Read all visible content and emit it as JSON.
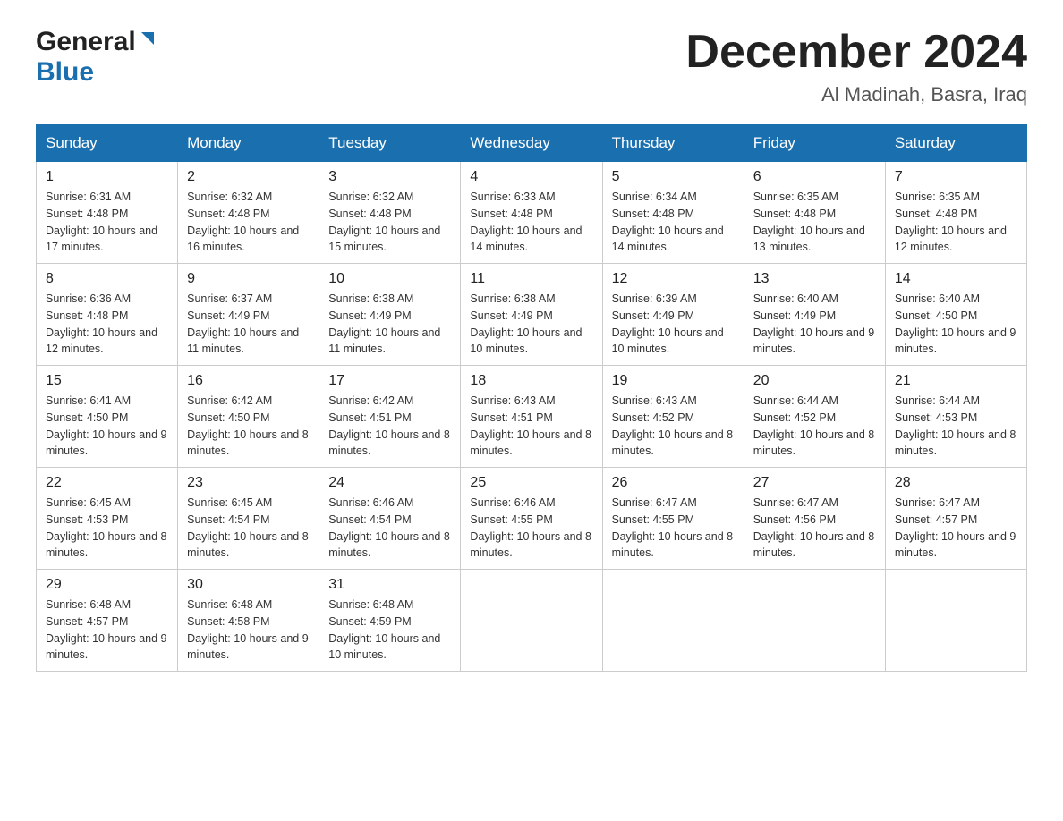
{
  "header": {
    "logo_general": "General",
    "logo_blue": "Blue",
    "title": "December 2024",
    "subtitle": "Al Madinah, Basra, Iraq"
  },
  "days_of_week": [
    "Sunday",
    "Monday",
    "Tuesday",
    "Wednesday",
    "Thursday",
    "Friday",
    "Saturday"
  ],
  "weeks": [
    [
      {
        "day": "1",
        "sunrise": "6:31 AM",
        "sunset": "4:48 PM",
        "daylight": "10 hours and 17 minutes."
      },
      {
        "day": "2",
        "sunrise": "6:32 AM",
        "sunset": "4:48 PM",
        "daylight": "10 hours and 16 minutes."
      },
      {
        "day": "3",
        "sunrise": "6:32 AM",
        "sunset": "4:48 PM",
        "daylight": "10 hours and 15 minutes."
      },
      {
        "day": "4",
        "sunrise": "6:33 AM",
        "sunset": "4:48 PM",
        "daylight": "10 hours and 14 minutes."
      },
      {
        "day": "5",
        "sunrise": "6:34 AM",
        "sunset": "4:48 PM",
        "daylight": "10 hours and 14 minutes."
      },
      {
        "day": "6",
        "sunrise": "6:35 AM",
        "sunset": "4:48 PM",
        "daylight": "10 hours and 13 minutes."
      },
      {
        "day": "7",
        "sunrise": "6:35 AM",
        "sunset": "4:48 PM",
        "daylight": "10 hours and 12 minutes."
      }
    ],
    [
      {
        "day": "8",
        "sunrise": "6:36 AM",
        "sunset": "4:48 PM",
        "daylight": "10 hours and 12 minutes."
      },
      {
        "day": "9",
        "sunrise": "6:37 AM",
        "sunset": "4:49 PM",
        "daylight": "10 hours and 11 minutes."
      },
      {
        "day": "10",
        "sunrise": "6:38 AM",
        "sunset": "4:49 PM",
        "daylight": "10 hours and 11 minutes."
      },
      {
        "day": "11",
        "sunrise": "6:38 AM",
        "sunset": "4:49 PM",
        "daylight": "10 hours and 10 minutes."
      },
      {
        "day": "12",
        "sunrise": "6:39 AM",
        "sunset": "4:49 PM",
        "daylight": "10 hours and 10 minutes."
      },
      {
        "day": "13",
        "sunrise": "6:40 AM",
        "sunset": "4:49 PM",
        "daylight": "10 hours and 9 minutes."
      },
      {
        "day": "14",
        "sunrise": "6:40 AM",
        "sunset": "4:50 PM",
        "daylight": "10 hours and 9 minutes."
      }
    ],
    [
      {
        "day": "15",
        "sunrise": "6:41 AM",
        "sunset": "4:50 PM",
        "daylight": "10 hours and 9 minutes."
      },
      {
        "day": "16",
        "sunrise": "6:42 AM",
        "sunset": "4:50 PM",
        "daylight": "10 hours and 8 minutes."
      },
      {
        "day": "17",
        "sunrise": "6:42 AM",
        "sunset": "4:51 PM",
        "daylight": "10 hours and 8 minutes."
      },
      {
        "day": "18",
        "sunrise": "6:43 AM",
        "sunset": "4:51 PM",
        "daylight": "10 hours and 8 minutes."
      },
      {
        "day": "19",
        "sunrise": "6:43 AM",
        "sunset": "4:52 PM",
        "daylight": "10 hours and 8 minutes."
      },
      {
        "day": "20",
        "sunrise": "6:44 AM",
        "sunset": "4:52 PM",
        "daylight": "10 hours and 8 minutes."
      },
      {
        "day": "21",
        "sunrise": "6:44 AM",
        "sunset": "4:53 PM",
        "daylight": "10 hours and 8 minutes."
      }
    ],
    [
      {
        "day": "22",
        "sunrise": "6:45 AM",
        "sunset": "4:53 PM",
        "daylight": "10 hours and 8 minutes."
      },
      {
        "day": "23",
        "sunrise": "6:45 AM",
        "sunset": "4:54 PM",
        "daylight": "10 hours and 8 minutes."
      },
      {
        "day": "24",
        "sunrise": "6:46 AM",
        "sunset": "4:54 PM",
        "daylight": "10 hours and 8 minutes."
      },
      {
        "day": "25",
        "sunrise": "6:46 AM",
        "sunset": "4:55 PM",
        "daylight": "10 hours and 8 minutes."
      },
      {
        "day": "26",
        "sunrise": "6:47 AM",
        "sunset": "4:55 PM",
        "daylight": "10 hours and 8 minutes."
      },
      {
        "day": "27",
        "sunrise": "6:47 AM",
        "sunset": "4:56 PM",
        "daylight": "10 hours and 8 minutes."
      },
      {
        "day": "28",
        "sunrise": "6:47 AM",
        "sunset": "4:57 PM",
        "daylight": "10 hours and 9 minutes."
      }
    ],
    [
      {
        "day": "29",
        "sunrise": "6:48 AM",
        "sunset": "4:57 PM",
        "daylight": "10 hours and 9 minutes."
      },
      {
        "day": "30",
        "sunrise": "6:48 AM",
        "sunset": "4:58 PM",
        "daylight": "10 hours and 9 minutes."
      },
      {
        "day": "31",
        "sunrise": "6:48 AM",
        "sunset": "4:59 PM",
        "daylight": "10 hours and 10 minutes."
      },
      null,
      null,
      null,
      null
    ]
  ],
  "labels": {
    "sunrise": "Sunrise:",
    "sunset": "Sunset:",
    "daylight": "Daylight:"
  }
}
